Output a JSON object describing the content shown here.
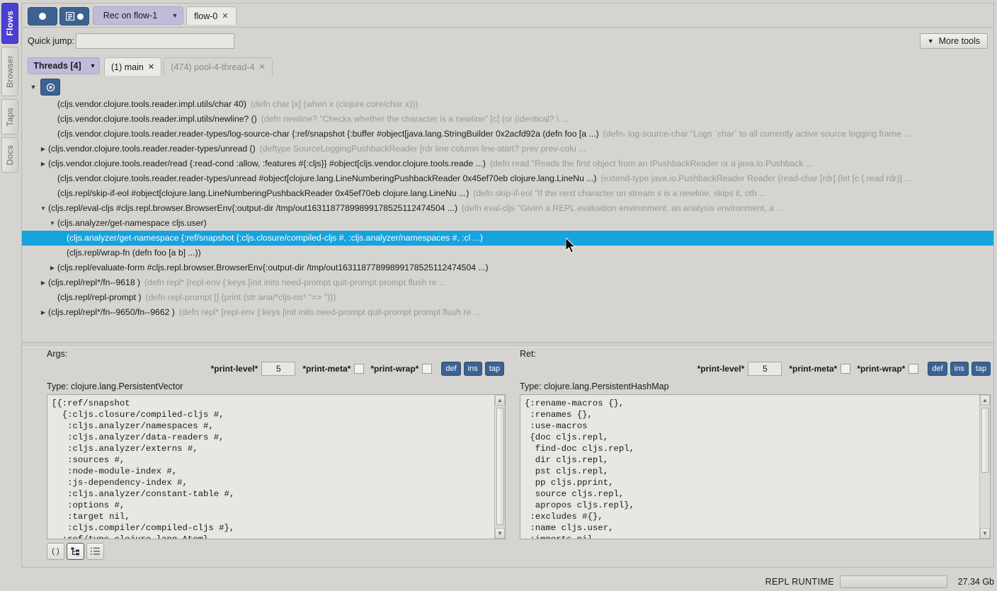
{
  "rail": {
    "tabs": [
      {
        "label": "Flows",
        "selected": true
      },
      {
        "label": "Browser",
        "selected": false
      },
      {
        "label": "Taps",
        "selected": false
      },
      {
        "label": "Docs",
        "selected": false
      }
    ]
  },
  "toolbar": {
    "record_button": "record-icon",
    "record_tree_button": "record-tree-icon",
    "rec_select_label": "Rec on flow-1",
    "caret": "▼",
    "flow_tabs": [
      {
        "label": "flow-0",
        "close": "✕",
        "selected": true
      }
    ]
  },
  "quickjump": {
    "label": "Quick jump:",
    "value": "",
    "placeholder": ""
  },
  "more_tools": {
    "label": "More tools",
    "caret": "▼"
  },
  "threads": {
    "button_label": "Threads [4]",
    "caret": "▼",
    "tabs": [
      {
        "label": "(1) main",
        "close": "✕",
        "active": true
      },
      {
        "label": "(474) pool-4-thread-4",
        "close": "✕",
        "active": false
      }
    ]
  },
  "tree": {
    "root": {
      "arrow": "▼",
      "icon": "record-target-icon"
    },
    "rows": [
      {
        "indent": 2,
        "arrow": "",
        "code": "(cljs.vendor.clojure.tools.reader.impl.utils/char 40)",
        "doc": "(defn char [x] (when x (clojure.core/char x)))",
        "selected": false
      },
      {
        "indent": 2,
        "arrow": "",
        "code": "(cljs.vendor.clojure.tools.reader.impl.utils/newline? ()",
        "doc": "(defn newline? \"Checks whether the character is a newline\" [c] (or (identical? \\ ...",
        "selected": false
      },
      {
        "indent": 2,
        "arrow": "",
        "code": "(cljs.vendor.clojure.tools.reader.reader-types/log-source-char {:ref/snapshot {:buffer #object[java.lang.StringBuilder 0x2acfd92a (defn foo [a ...)",
        "doc": "(defn- log-source-char \"Logs `char` to all currently active source logging frame ...",
        "selected": false
      },
      {
        "indent": 1,
        "arrow": "▶",
        "code": "(cljs.vendor.clojure.tools.reader.reader-types/unread ()",
        "doc": "(deftype SourceLoggingPushbackReader [rdr line column line-start? prev prev-colu ...",
        "selected": false
      },
      {
        "indent": 1,
        "arrow": "▶",
        "code": "(cljs.vendor.clojure.tools.reader/read {:read-cond :allow, :features #{:cljs}} #object[cljs.vendor.clojure.tools.reade ...)",
        "doc": "(defn read \"Reads the first object from an IPushbackReader or a java.io.Pushback ...",
        "selected": false
      },
      {
        "indent": 2,
        "arrow": "",
        "code": "(cljs.vendor.clojure.tools.reader.reader-types/unread #object[clojure.lang.LineNumberingPushbackReader 0x45ef70eb clojure.lang.LineNu ...)",
        "doc": "(extend-type java.io.PushbackReader Reader (read-char [rdr] (let [c (.read rdr)] ...",
        "selected": false
      },
      {
        "indent": 2,
        "arrow": "",
        "code": "(cljs.repl/skip-if-eol #object[clojure.lang.LineNumberingPushbackReader 0x45ef70eb clojure.lang.LineNu ...)",
        "doc": "(defn skip-if-eol \"If the next character on stream s is a newline, skips it, oth ...",
        "selected": false
      },
      {
        "indent": 1,
        "arrow": "▼",
        "code": "(cljs.repl/eval-cljs #cljs.repl.browser.BrowserEnv{:output-dir /tmp/out16311877899899178525112474504 ...)",
        "doc": "(defn eval-cljs \"Given a REPL evaluation environment, an analysis environment, a ...",
        "selected": false
      },
      {
        "indent": 2,
        "arrow": "▼",
        "code": "(cljs.analyzer/get-namespace cljs.user)",
        "doc": "",
        "selected": false
      },
      {
        "indent": 3,
        "arrow": "",
        "code": "(cljs.analyzer/get-namespace {:ref/snapshot {:cljs.closure/compiled-cljs #, :cljs.analyzer/namespaces #, :cl ...)",
        "doc": "",
        "selected": true
      },
      {
        "indent": 3,
        "arrow": "",
        "code": "(cljs.repl/wrap-fn (defn foo [a b] ...))",
        "doc": "",
        "selected": false
      },
      {
        "indent": 2,
        "arrow": "▶",
        "code": "(cljs.repl/evaluate-form #cljs.repl.browser.BrowserEnv{:output-dir /tmp/out16311877899899178525112474504 ...)",
        "doc": "",
        "selected": false
      },
      {
        "indent": 1,
        "arrow": "▶",
        "code": "(cljs.repl/repl*/fn--9618 )",
        "doc": "(defn repl* [repl-env {:keys [init inits need-prompt quit-prompt prompt flush re ...",
        "selected": false
      },
      {
        "indent": 2,
        "arrow": "",
        "code": "(cljs.repl/repl-prompt )",
        "doc": "(defn repl-prompt [] (print (str ana/*cljs-ns* \"=> \")))",
        "selected": false
      },
      {
        "indent": 1,
        "arrow": "▶",
        "code": "(cljs.repl/repl*/fn--9650/fn--9662 )",
        "doc": "(defn repl* [repl-env {:keys [init inits need-prompt quit-prompt prompt flush re ...",
        "selected": false
      }
    ]
  },
  "args_pane": {
    "title": "Args:",
    "print_level_label": "*print-level*",
    "print_level_value": "5",
    "print_meta_label": "*print-meta*",
    "print_meta_checked": false,
    "print_wrap_label": "*print-wrap*",
    "print_wrap_checked": false,
    "buttons": [
      {
        "label": "def"
      },
      {
        "label": "ins"
      },
      {
        "label": "tap"
      }
    ],
    "type_line": "Type: clojure.lang.PersistentVector",
    "code": "[{:ref/snapshot\n  {:cljs.closure/compiled-cljs #,\n   :cljs.analyzer/namespaces #,\n   :cljs.analyzer/data-readers #,\n   :cljs.analyzer/externs #,\n   :sources #,\n   :node-module-index #,\n   :js-dependency-index #,\n   :cljs.analyzer/constant-table #,\n   :options #,\n   :target nil,\n   :cljs.compiler/compiled-cljs #},\n  :ref/type clojure.lang.Atom}\n cljs.user]"
  },
  "ret_pane": {
    "title": "Ret:",
    "print_level_label": "*print-level*",
    "print_level_value": "5",
    "print_meta_label": "*print-meta*",
    "print_meta_checked": false,
    "print_wrap_label": "*print-wrap*",
    "print_wrap_checked": false,
    "buttons": [
      {
        "label": "def"
      },
      {
        "label": "ins"
      },
      {
        "label": "tap"
      }
    ],
    "type_line": "Type: clojure.lang.PersistentHashMap",
    "code": "{:rename-macros {},\n :renames {},\n :use-macros\n {doc cljs.repl,\n  find-doc cljs.repl,\n  dir cljs.repl,\n  pst cljs.repl,\n  pp cljs.pprint,\n  source cljs.repl,\n  apropos cljs.repl},\n :excludes #{},\n :name cljs.user,\n :imports nil,\n :requires"
  },
  "view_toolbar": {
    "buttons": [
      {
        "label": "( )",
        "name": "pprint-view-button",
        "active": false
      },
      {
        "label": "tree-view-icon",
        "name": "tree-view-button",
        "active": true
      },
      {
        "label": "list-view-icon",
        "name": "list-view-button",
        "active": false
      }
    ]
  },
  "status": {
    "label": "REPL  RUNTIME",
    "memory": "27.34 Gb",
    "progress": ""
  },
  "colors": {
    "accent_blue": "#3b6293",
    "selection_blue": "#16a3de",
    "rail_selected": "#4b3fd4",
    "lavender": "#bfbcdb",
    "background": "#d6d4d0"
  }
}
